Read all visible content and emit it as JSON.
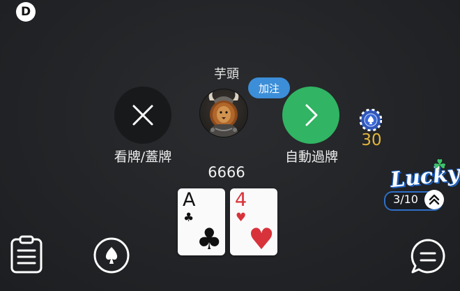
{
  "dealer": {
    "label": "D"
  },
  "player": {
    "name": "芋頭",
    "chips": "6666",
    "action_bubble": "加注"
  },
  "actions": {
    "fold_label": "看牌/蓋牌",
    "auto_check_label": "自動過牌"
  },
  "bet": {
    "amount": "30"
  },
  "cards": [
    {
      "rank": "A",
      "suit": "♣",
      "color": "black"
    },
    {
      "rank": "4",
      "suit": "♥",
      "color": "red"
    }
  ],
  "lucky": {
    "title": "Lucky",
    "progress": "3/10"
  },
  "colors": {
    "auto_check_button": "#31b463",
    "raise_bubble": "#3c8ed8",
    "bet_amount": "#e2b53c",
    "heart": "#d8333a"
  },
  "icons": [
    "history-icon",
    "spade-icon",
    "chat-icon",
    "close-icon",
    "chevron-right-icon",
    "double-chevron-up-icon",
    "poker-chip-icon",
    "clover-icon"
  ]
}
